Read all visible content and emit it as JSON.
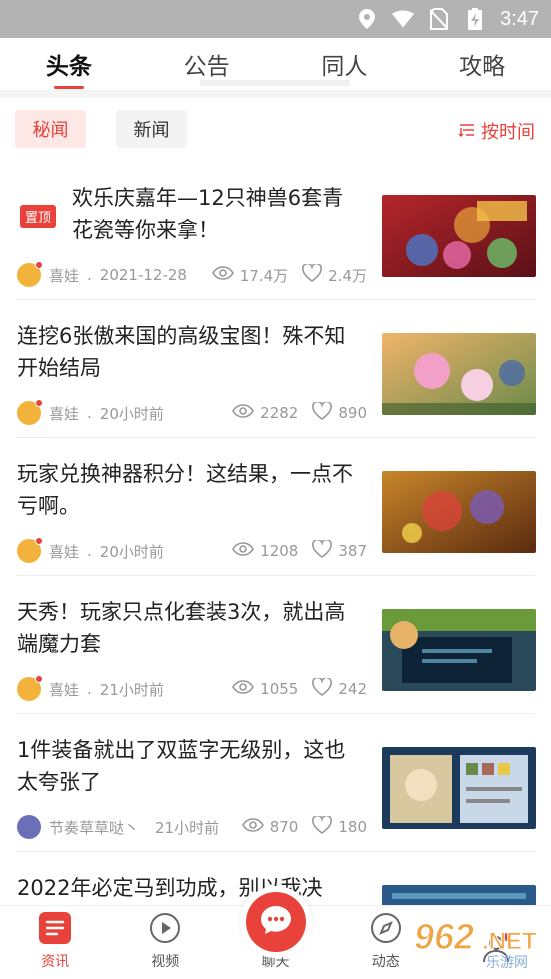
{
  "status": {
    "time": "3:47"
  },
  "tabs": [
    {
      "label": "头条",
      "active": true
    },
    {
      "label": "公告",
      "active": false
    },
    {
      "label": "同人",
      "active": false
    },
    {
      "label": "攻略",
      "active": false
    }
  ],
  "filters": {
    "secret": "秘闻",
    "news": "新闻",
    "sort": "按时间"
  },
  "pin_label": "置顶",
  "items": [
    {
      "title": "欢乐庆嘉年—12只神兽6套青花瓷等你来拿！",
      "author": "喜娃",
      "time": "2021-12-28",
      "views": "17.4万",
      "likes": "2.4万",
      "pinned": true
    },
    {
      "title": "连挖6张傲来国的高级宝图！殊不知开始结局",
      "author": "喜娃",
      "time": "20小时前",
      "views": "2282",
      "likes": "890",
      "pinned": false
    },
    {
      "title": "玩家兑换神器积分！这结果，一点不亏啊。",
      "author": "喜娃",
      "time": "20小时前",
      "views": "1208",
      "likes": "387",
      "pinned": false
    },
    {
      "title": "天秀！玩家只点化套装3次，就出高端魔力套",
      "author": "喜娃",
      "time": "21小时前",
      "views": "1055",
      "likes": "242",
      "pinned": false
    },
    {
      "title": "1件装备就出了双蓝字无级别，这也太夸张了",
      "author": "节奏草草哒丶",
      "time": "21小时前",
      "views": "870",
      "likes": "180",
      "pinned": false
    },
    {
      "title": "2022年必定马到功成，别以我决",
      "author": "",
      "time": "",
      "views": "",
      "likes": "",
      "pinned": false
    }
  ],
  "nav": {
    "news": "资讯",
    "video": "视频",
    "chat": "聊天",
    "moments": "动态",
    "me": ""
  },
  "logo": {
    "number": "962",
    "tld": ".NET",
    "sub": "乐游网"
  },
  "colors": {
    "accent": "#e9423b"
  }
}
